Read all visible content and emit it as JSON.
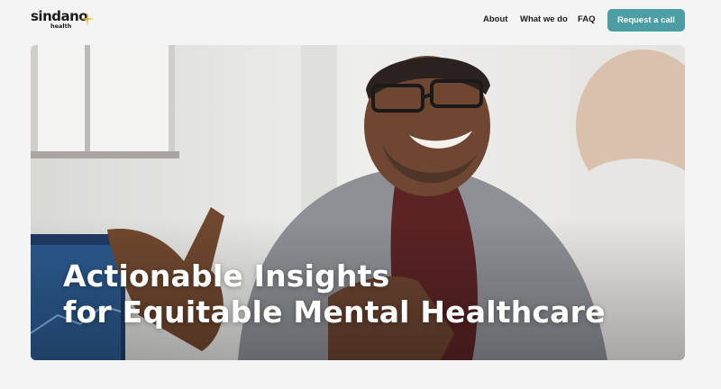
{
  "logo": {
    "wordmark": "sindano",
    "sub": "health"
  },
  "nav": {
    "about": "About",
    "what_we_do": "What we do",
    "faq": "FAQ",
    "cta": "Request a call"
  },
  "hero": {
    "title_line1": "Actionable Insights",
    "title_line2": "for Equitable Mental Healthcare"
  },
  "colors": {
    "accent": "#4a9ea4",
    "background": "#f4f4f4",
    "text": "#1b1b1b"
  }
}
